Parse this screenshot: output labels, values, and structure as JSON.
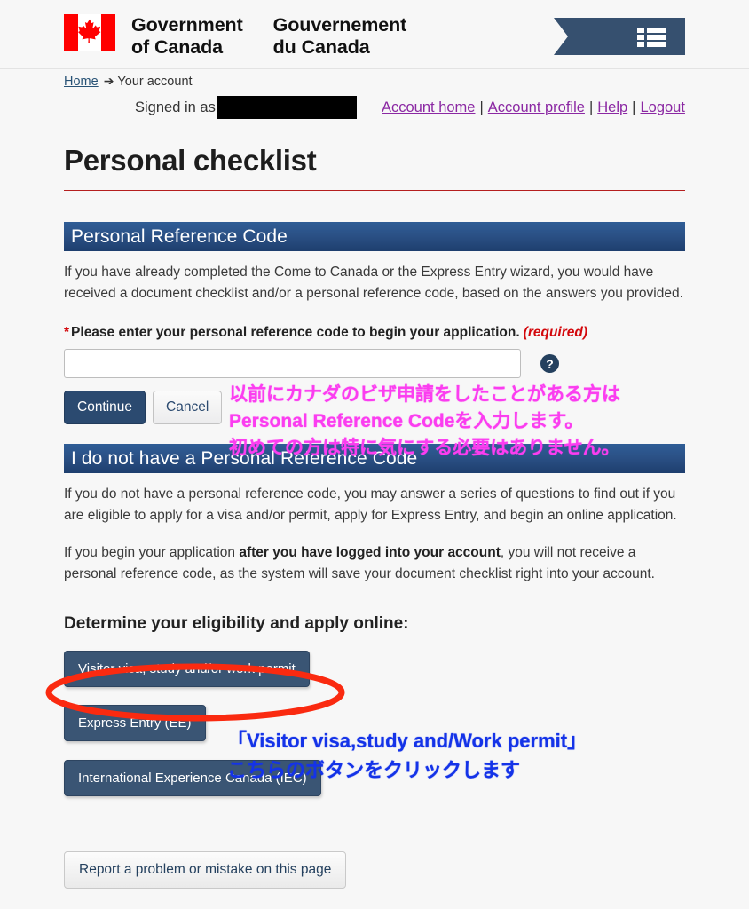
{
  "header": {
    "wordmark_en": "Government\nof Canada",
    "wordmark_fr": "Gouvernement\ndu Canada",
    "flag_icon": "canada-flag-icon",
    "maple_leaf": "🍁",
    "menu_icon": "list-menu-icon"
  },
  "breadcrumb": {
    "home": "Home",
    "arrow": "➔",
    "current": "Your account"
  },
  "account_bar": {
    "signed_in_as": "Signed in as",
    "username_redacted": "",
    "links": [
      {
        "label": "Account home"
      },
      {
        "label": "Account profile"
      },
      {
        "label": "Help"
      },
      {
        "label": "Logout"
      }
    ],
    "separator": "|"
  },
  "main": {
    "page_title": "Personal checklist",
    "sections": [
      {
        "heading": "Personal Reference Code",
        "paragraph": "If you have already completed the Come to Canada or the Express Entry wizard, you would have received a document checklist and/or a personal reference code, based on the answers you provided.",
        "field": {
          "asterisk": "*",
          "label": "Please enter your personal reference code to begin your application.",
          "required_note": "(required)",
          "value": "",
          "placeholder": "",
          "help_icon": "question-mark-icon",
          "help_glyph": "?"
        },
        "buttons": {
          "continue": "Continue",
          "cancel": "Cancel"
        }
      },
      {
        "heading": "I do not have a Personal Reference Code",
        "paragraph_1": "If you do not have a personal reference code, you may answer a series of questions to find out if you are eligible to apply for a visa and/or permit, apply for Express Entry, and begin an online application.",
        "paragraph_2_pre": "If you begin your application ",
        "paragraph_2_bold": "after you have logged into your account",
        "paragraph_2_post": ", you will not receive a personal reference code, as the system will save your document checklist right into your account."
      }
    ],
    "eligibility_heading": "Determine your eligibility and apply online:",
    "eligibility_buttons": [
      {
        "label": "Visitor visa, study and/or work permit"
      },
      {
        "label": "Express Entry (EE)"
      },
      {
        "label": "International Experience Canada (IEC)"
      }
    ],
    "report_button": "Report a problem or mistake on this page"
  },
  "annotations": {
    "pink_note": "以前にカナダのビザ申請をしたことがある方は\nPersonal Reference Codeを入力します。\n初めての方は特に気にする必要はありません。",
    "blue_note": "「Visitor visa,study and/Work permit」\nこちらのボタンをクリックします",
    "ellipse_icon": "red-ellipse-highlight"
  },
  "colors": {
    "pink": "#fb3df0",
    "blue": "#1433e8",
    "red": "#fa2a10",
    "header_blue": "#2b5186",
    "flag_red": "#ff0000",
    "link_purple": "#8b28a3",
    "title_rule": "#b51f1f"
  }
}
